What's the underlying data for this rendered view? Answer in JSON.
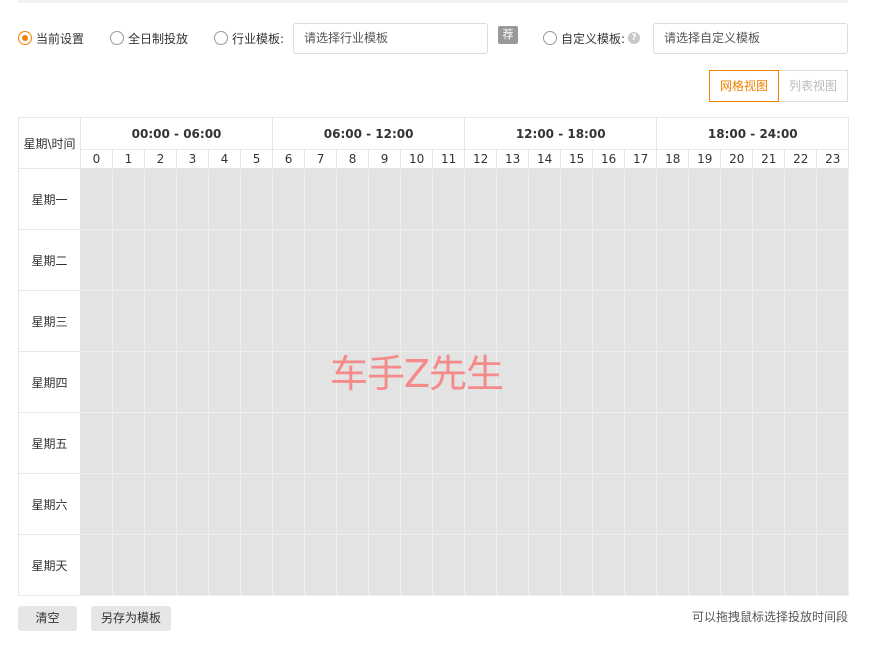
{
  "mode_options": [
    {
      "label": "当前设置",
      "checked": true
    },
    {
      "label": "全日制投放",
      "checked": false
    },
    {
      "label": "行业模板:",
      "checked": false
    },
    {
      "label": "自定义模板:",
      "checked": false
    }
  ],
  "industry_template": {
    "placeholder": "请选择行业模板",
    "recommend_badge": "荐"
  },
  "custom_template": {
    "placeholder": "请选择自定义模板",
    "help_icon": "?"
  },
  "view_toggle": {
    "grid_label": "网格视图",
    "list_label": "列表视图",
    "active": "grid"
  },
  "schedule": {
    "corner_label": "星期\\时间",
    "ranges": [
      "00:00 - 06:00",
      "06:00 - 12:00",
      "12:00 - 18:00",
      "18:00 - 24:00"
    ],
    "hours": [
      "0",
      "1",
      "2",
      "3",
      "4",
      "5",
      "6",
      "7",
      "8",
      "9",
      "10",
      "11",
      "12",
      "13",
      "14",
      "15",
      "16",
      "17",
      "18",
      "19",
      "20",
      "21",
      "22",
      "23"
    ],
    "days": [
      "星期一",
      "星期二",
      "星期三",
      "星期四",
      "星期五",
      "星期六",
      "星期天"
    ]
  },
  "watermark": "车手Z先生",
  "footer": {
    "clear_label": "清空",
    "save_template_label": "另存为模板",
    "hint": "可以拖拽鼠标选择投放时间段"
  },
  "colors": {
    "accent": "#f08200",
    "cell_unselected": "#e3e3e3",
    "watermark": "#f58a8a"
  }
}
